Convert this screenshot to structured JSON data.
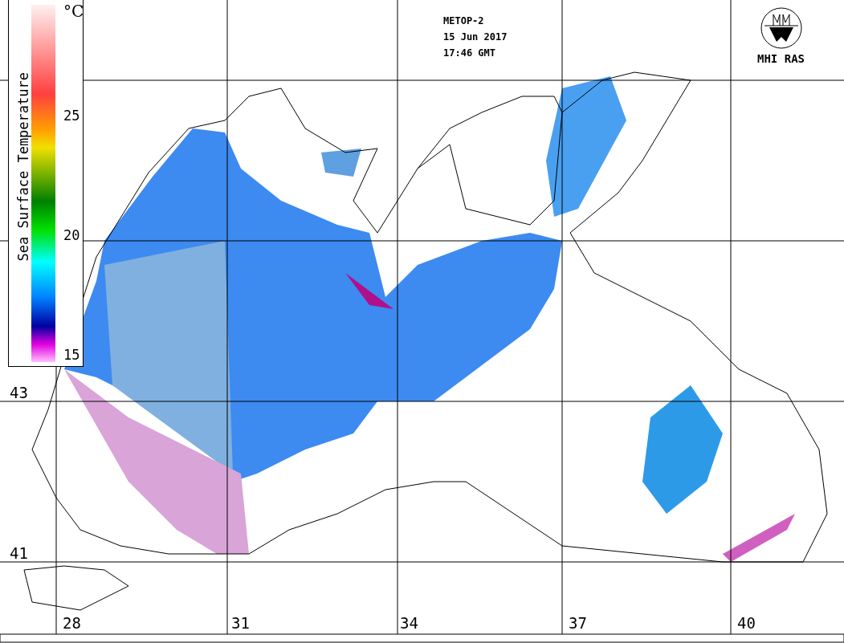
{
  "satellite_info": [
    "METOP-2",
    "15 Jun 2017",
    "17:46 GMT"
  ],
  "logo": {
    "text": "MHI RAS"
  },
  "colorbar": {
    "title": "Sea Surface Temperature",
    "unit": "°C",
    "ticks": [
      "25",
      "20",
      "15"
    ]
  },
  "latitude_labels": [
    "43",
    "41"
  ],
  "longitude_labels": [
    "28",
    "31",
    "34",
    "37",
    "40"
  ]
}
